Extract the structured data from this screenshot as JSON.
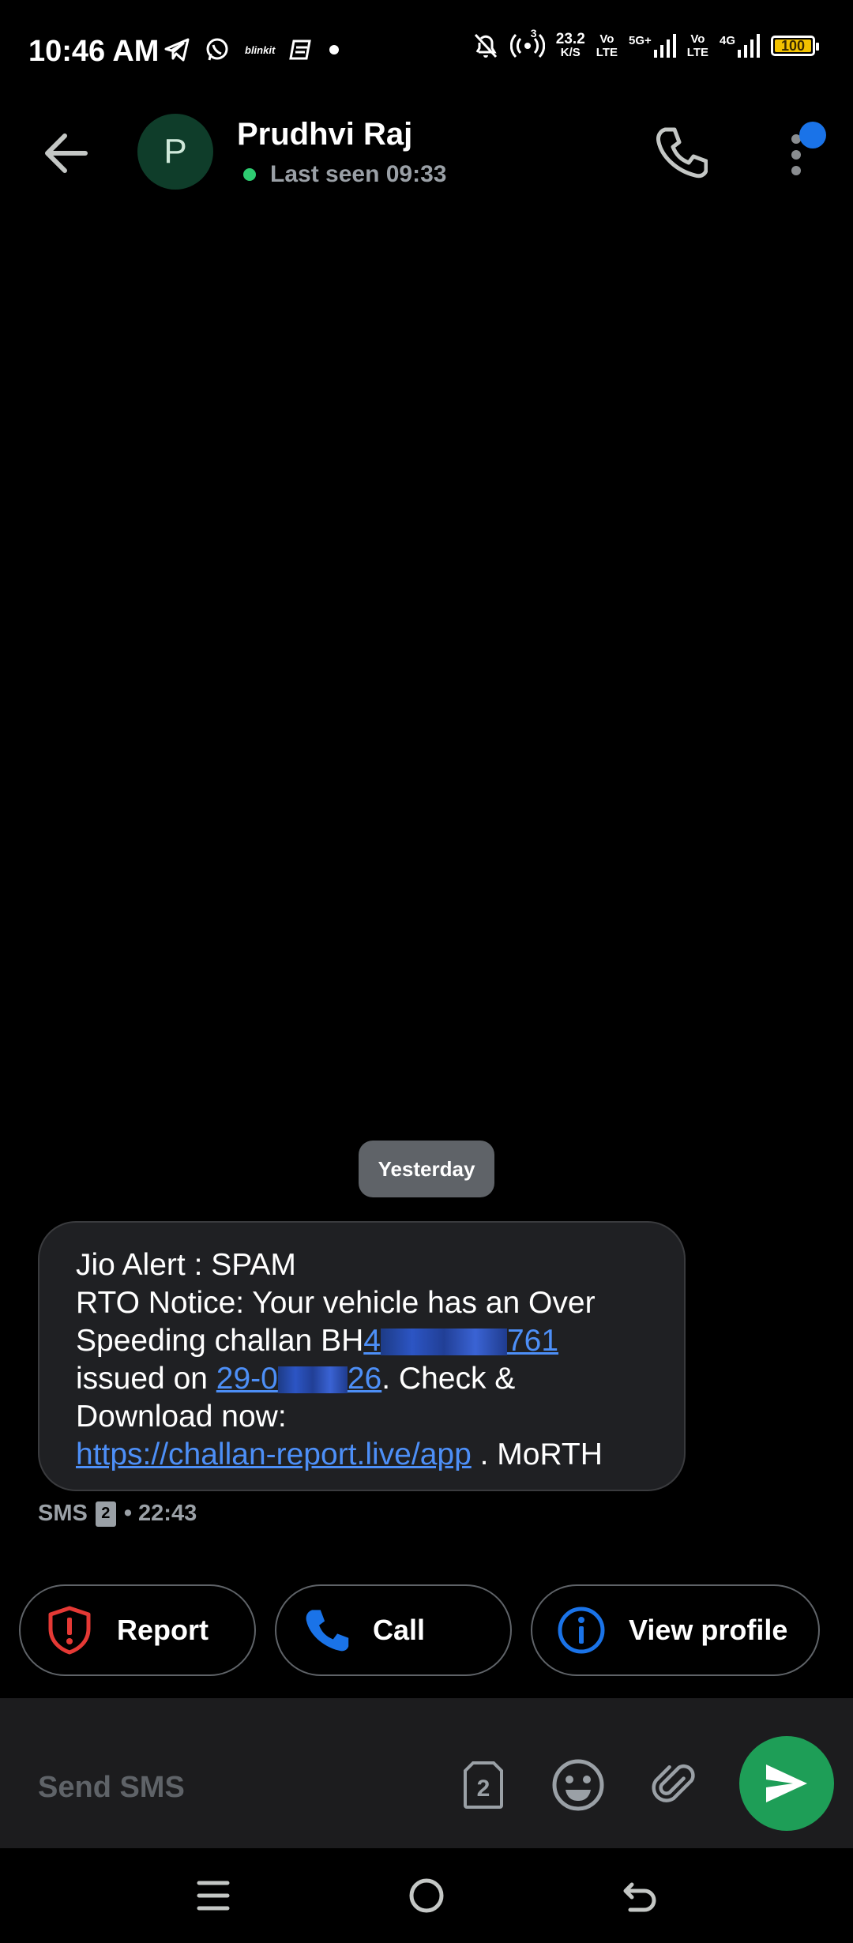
{
  "status_bar": {
    "time": "10:46 AM",
    "net_speed_value": "23.2",
    "net_speed_unit": "K/S",
    "volte1_top": "Vo",
    "volte1_bottom": "LTE",
    "net_5g": "5G+",
    "volte2_top": "Vo",
    "volte2_bottom": "LTE",
    "net_4g": "4G",
    "battery": "100",
    "hotspot_count": "3",
    "left_icons": [
      "telegram-icon",
      "whatsapp-icon",
      "blinkit-icon",
      "gallery-icon",
      "dot-icon"
    ],
    "blinkit_label": "blinkit"
  },
  "header": {
    "avatar_letter": "P",
    "contact_name": "Prudhvi Raj",
    "last_seen": "Last seen 09:33",
    "online_color": "#2ecc71"
  },
  "conversation": {
    "date_chip": "Yesterday",
    "message": {
      "line1": "Jio Alert : SPAM",
      "line2": "RTO Notice: Your vehicle has an Over",
      "line3_text": "Speeding challan BH",
      "line3_link_start": "4",
      "line3_link_end": "761",
      "line4_text": "issued on ",
      "line4_link_start": "29-0",
      "line4_link_end": "26",
      "line4_tail": ". Check &",
      "line5": "Download now:",
      "line6_link": "https://challan-report.live/app",
      "line6_tail": " . MoRTH"
    },
    "meta_type": "SMS",
    "meta_sim": "2",
    "meta_time": "• 22:43"
  },
  "actions": {
    "report": "Report",
    "call": "Call",
    "view_profile": "View profile"
  },
  "composer": {
    "placeholder": "Send SMS",
    "sim_label": "2"
  },
  "colors": {
    "accent_blue": "#1a73e8",
    "link_blue": "#4d8ff7",
    "report_red": "#e53935",
    "send_green": "#1e9e57"
  }
}
